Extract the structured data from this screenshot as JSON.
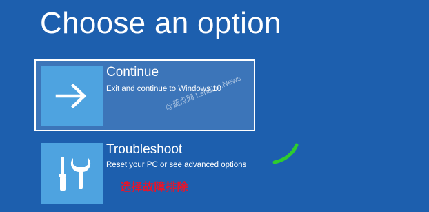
{
  "header": {
    "title": "Choose an option"
  },
  "options": [
    {
      "id": "continue",
      "title": "Continue",
      "description": "Exit and continue to Windows 10",
      "icon": "arrow-right-icon"
    },
    {
      "id": "troubleshoot",
      "title": "Troubleshoot",
      "description": "Reset your PC or see advanced options",
      "icon": "tools-icon"
    }
  ],
  "watermark": {
    "text": "@蓝点网 Landian.News"
  },
  "annotation": {
    "text": "选择故障排除",
    "color": "#e8142a"
  },
  "colors": {
    "background": "#1d5fae",
    "tile": "#4ea3e0",
    "annotation_mark": "#2ecc2e"
  }
}
